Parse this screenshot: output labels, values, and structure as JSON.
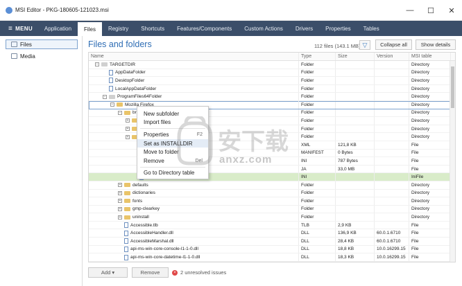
{
  "window": {
    "title": "MSI Editor - PKG-180605-121023.msi",
    "minimize": "—",
    "maximize": "☐",
    "close": "✕"
  },
  "menubar": {
    "menu_label": "MENU",
    "tabs": [
      "Application",
      "Files",
      "Registry",
      "Shortcuts",
      "Features/Components",
      "Custom Actions",
      "Drivers",
      "Properties",
      "Tables"
    ],
    "active_tab": "Files"
  },
  "sidebar": {
    "items": [
      {
        "label": "Files",
        "selected": true
      },
      {
        "label": "Media",
        "selected": false
      }
    ]
  },
  "panel": {
    "title": "Files and folders",
    "file_count": "112 files (143.1 MB)",
    "collapse_all": "Collapse all",
    "show_details": "Show details"
  },
  "grid": {
    "columns": [
      "Name",
      "Type",
      "Size",
      "Version",
      "MSI table"
    ],
    "rows": [
      {
        "indent": 0,
        "exp": "−",
        "icon": "folder-grey",
        "name": "TARGETDIR",
        "type": "Folder",
        "size": "",
        "version": "",
        "msi": "Directory"
      },
      {
        "indent": 1,
        "exp": "",
        "icon": "folder-blank",
        "name": "AppDataFolder",
        "type": "Folder",
        "size": "",
        "version": "",
        "msi": "Directory"
      },
      {
        "indent": 1,
        "exp": "",
        "icon": "folder-blank",
        "name": "DesktopFolder",
        "type": "Folder",
        "size": "",
        "version": "",
        "msi": "Directory"
      },
      {
        "indent": 1,
        "exp": "",
        "icon": "folder-blank",
        "name": "LocalAppDataFolder",
        "type": "Folder",
        "size": "",
        "version": "",
        "msi": "Directory"
      },
      {
        "indent": 1,
        "exp": "−",
        "icon": "folder-grey",
        "name": "ProgramFiles64Folder",
        "type": "Folder",
        "size": "",
        "version": "",
        "msi": "Directory"
      },
      {
        "indent": 2,
        "exp": "−",
        "icon": "folder",
        "name": "Mozilla Firefox",
        "type": "Folder",
        "size": "",
        "version": "",
        "msi": "Directory",
        "selected": true
      },
      {
        "indent": 3,
        "exp": "−",
        "icon": "folder",
        "name": "brow",
        "type": "Folder",
        "size": "",
        "version": "",
        "msi": "Directory"
      },
      {
        "indent": 4,
        "exp": "+",
        "icon": "folder",
        "name": "",
        "type": "Folder",
        "size": "",
        "version": "",
        "msi": "Directory"
      },
      {
        "indent": 4,
        "exp": "+",
        "icon": "folder",
        "name": "",
        "type": "Folder",
        "size": "",
        "version": "",
        "msi": "Directory"
      },
      {
        "indent": 4,
        "exp": "+",
        "icon": "folder",
        "name": "",
        "type": "Folder",
        "size": "",
        "version": "",
        "msi": "Directory"
      },
      {
        "indent": 5,
        "exp": "",
        "icon": "file",
        "name": "",
        "type": "XML",
        "size": "121,8 KB",
        "version": "",
        "msi": "File"
      },
      {
        "indent": 5,
        "exp": "",
        "icon": "file",
        "name": "",
        "type": "MANIFEST",
        "size": "0 Bytes",
        "version": "",
        "msi": "File"
      },
      {
        "indent": 5,
        "exp": "",
        "icon": "file",
        "name": "",
        "type": "INI",
        "size": "787 Bytes",
        "version": "",
        "msi": "File"
      },
      {
        "indent": 5,
        "exp": "",
        "icon": "file",
        "name": "",
        "type": "JA",
        "size": "33,0 MB",
        "version": "",
        "msi": "File"
      },
      {
        "indent": 5,
        "exp": "",
        "icon": "file",
        "name": "settings.ini",
        "type": "INI",
        "size": "",
        "version": "",
        "msi": "IniFile",
        "green": true
      },
      {
        "indent": 3,
        "exp": "+",
        "icon": "folder",
        "name": "defaults",
        "type": "Folder",
        "size": "",
        "version": "",
        "msi": "Directory"
      },
      {
        "indent": 3,
        "exp": "+",
        "icon": "folder",
        "name": "dictionaries",
        "type": "Folder",
        "size": "",
        "version": "",
        "msi": "Directory"
      },
      {
        "indent": 3,
        "exp": "+",
        "icon": "folder",
        "name": "fonts",
        "type": "Folder",
        "size": "",
        "version": "",
        "msi": "Directory"
      },
      {
        "indent": 3,
        "exp": "+",
        "icon": "folder",
        "name": "gmp-clearkey",
        "type": "Folder",
        "size": "",
        "version": "",
        "msi": "Directory"
      },
      {
        "indent": 3,
        "exp": "+",
        "icon": "folder",
        "name": "uninstall",
        "type": "Folder",
        "size": "",
        "version": "",
        "msi": "Directory"
      },
      {
        "indent": 3,
        "exp": "",
        "icon": "file",
        "name": "Accessible.tlb",
        "type": "TLB",
        "size": "2,9 KB",
        "version": "",
        "msi": "File"
      },
      {
        "indent": 3,
        "exp": "",
        "icon": "file",
        "name": "AccessibleHandler.dll",
        "type": "DLL",
        "size": "136,9 KB",
        "version": "60.0.1.6710",
        "msi": "File"
      },
      {
        "indent": 3,
        "exp": "",
        "icon": "file",
        "name": "AccessibleMarshal.dll",
        "type": "DLL",
        "size": "28,4 KB",
        "version": "60.0.1.6710",
        "msi": "File"
      },
      {
        "indent": 3,
        "exp": "",
        "icon": "file",
        "name": "api-ms-win-core-console-l1-1-0.dll",
        "type": "DLL",
        "size": "18,8 KB",
        "version": "10.0.16299.15",
        "msi": "File"
      },
      {
        "indent": 3,
        "exp": "",
        "icon": "file",
        "name": "api-ms-win-core-datetime-l1-1-0.dll",
        "type": "DLL",
        "size": "18,3 KB",
        "version": "10.0.16299.15",
        "msi": "File"
      }
    ]
  },
  "context_menu": {
    "items": [
      {
        "label": "New subfolder",
        "shortcut": ""
      },
      {
        "label": "Import files",
        "shortcut": ""
      },
      {
        "sep": true
      },
      {
        "label": "Properties",
        "shortcut": "F2"
      },
      {
        "label": "Set as INSTALLDIR",
        "shortcut": "",
        "highlight": true
      },
      {
        "label": "Move to folder",
        "shortcut": ""
      },
      {
        "label": "Remove",
        "shortcut": "Del"
      },
      {
        "sep": true
      },
      {
        "label": "Go to Directory table",
        "shortcut": ""
      }
    ]
  },
  "bottom": {
    "add": "Add",
    "add_arrow": "▾",
    "remove": "Remove",
    "issues": "2 unresolved issues",
    "issue_icon": "×"
  },
  "watermark": {
    "text": "anxz.com"
  },
  "colors": {
    "menubar": "#3b4e69",
    "accent": "#2e6db4",
    "highlight_row": "#d9ecc9",
    "folder": "#e9c46a"
  }
}
